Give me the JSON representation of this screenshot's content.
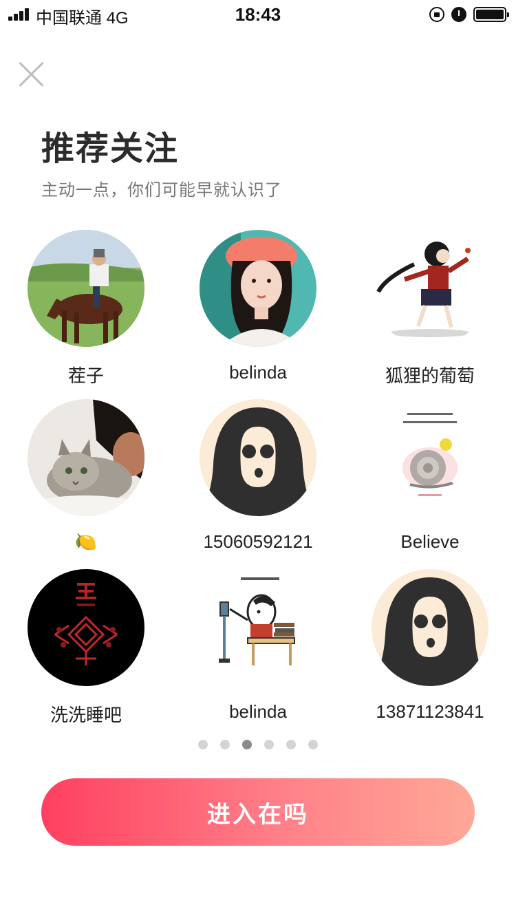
{
  "status_bar": {
    "carrier": "中国联通  4G",
    "time": "18:43",
    "battery_level": 1.0
  },
  "page": {
    "title": "推荐关注",
    "subtitle": "主动一点，你们可能早就认识了"
  },
  "users": [
    {
      "name": "茬子",
      "avatar": "horse-rider-photo"
    },
    {
      "name": "belinda",
      "avatar": "girl-hat-photo"
    },
    {
      "name": "狐狸的葡萄",
      "avatar": "cartoon-girl-illustration"
    },
    {
      "name": "🍋",
      "avatar": "cat-person-photo"
    },
    {
      "name": "15060592121",
      "avatar": "no-face-default-avatar"
    },
    {
      "name": "Believe",
      "avatar": "snail-illustration"
    },
    {
      "name": "洗洗睡吧",
      "avatar": "red-ornament-black"
    },
    {
      "name": "belinda",
      "avatar": "study-card-cartoon"
    },
    {
      "name": "13871123841",
      "avatar": "no-face-default-avatar"
    }
  ],
  "pagination": {
    "total": 6,
    "current": 3
  },
  "enter_button": {
    "label": "进入在吗"
  },
  "colors": {
    "button_start": "#ff3f5f",
    "button_end": "#ffa897",
    "dot_active": "#8a8a8a",
    "dot_inactive": "#d4d4d4"
  }
}
